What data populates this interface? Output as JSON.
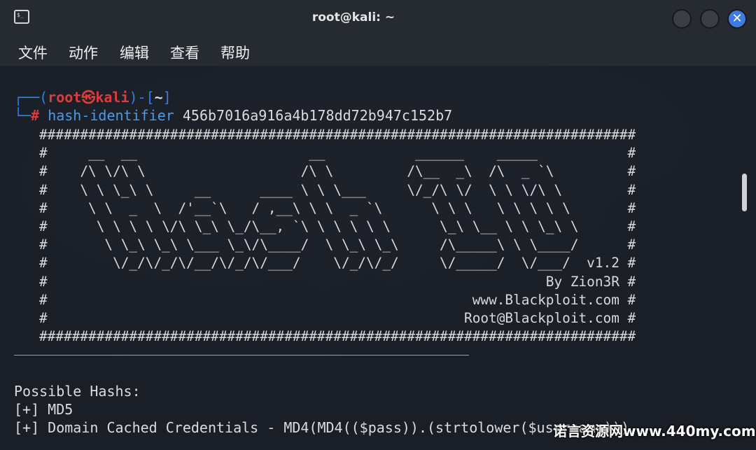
{
  "window": {
    "title": "root@kali: ~"
  },
  "menu": {
    "items": [
      "文件",
      "动作",
      "编辑",
      "查看",
      "帮助"
    ]
  },
  "prompt": {
    "line1_prefix": "┌──(",
    "user_host": "root㉿kali",
    "line1_mid": ")-[",
    "cwd": "~",
    "line1_suffix": "]",
    "line2_prefix": "└─",
    "hash_symbol": "#",
    "command": "hash-identifier",
    "argument": "456b7016a916a4b178dd72b947c152b7"
  },
  "banner_lines": [
    "#########################################################################",
    "#     __  __                     __           ______    _____           #",
    "#    /\\ \\/\\ \\                   /\\ \\         /\\__  _\\  /\\  _ `\\         #",
    "#    \\ \\ \\_\\ \\     __      ____ \\ \\ \\___     \\/_/\\ \\/  \\ \\ \\/\\ \\        #",
    "#     \\ \\  _  \\  /'__`\\   / ,__\\ \\ \\  _ `\\      \\ \\ \\   \\ \\ \\ \\ \\       #",
    "#      \\ \\ \\ \\ \\/\\ \\_\\ \\_/\\__, `\\ \\ \\ \\ \\ \\      \\_\\ \\__ \\ \\ \\_\\ \\      #",
    "#       \\ \\_\\ \\_\\ \\___ \\_\\/\\____/  \\ \\_\\ \\_\\     /\\_____\\ \\ \\____/      #",
    "#        \\/_/\\/_/\\/__/\\/_/\\/___/    \\/_/\\/_/     \\/_____/  \\/___/  v1.2 #",
    "#                                                             By Zion3R #",
    "#                                                    www.Blackploit.com #",
    "#                                                   Root@Blackploit.com #",
    "#########################################################################"
  ],
  "output": {
    "header": "Possible Hashs:",
    "results": [
      "[+] MD5",
      "[+] Domain Cached Credentials - MD4(MD4(($pass)).(strtolower($username)))"
    ]
  },
  "watermark": "诺言资源网www.440my.com"
}
